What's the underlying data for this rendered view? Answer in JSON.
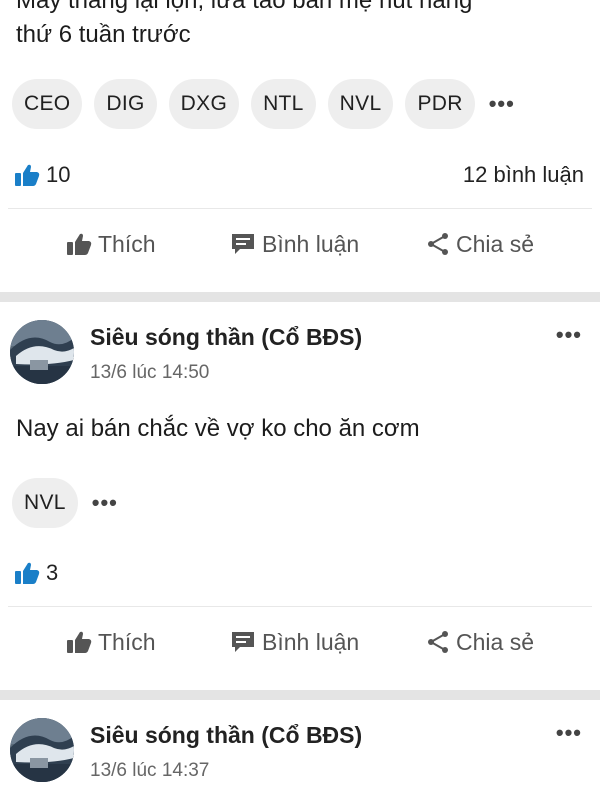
{
  "post1": {
    "text_line1": "Mấy tháng lại lộn, lừa tao bán mẹ hút hàng",
    "text_line2": "thứ 6 tuần trước",
    "tags": [
      "CEO",
      "DIG",
      "DXG",
      "NTL",
      "NVL",
      "PDR"
    ],
    "more": "•••",
    "likes": "10",
    "comments": "12 bình luận"
  },
  "post2": {
    "author": "Siêu sóng thần (Cổ BĐS)",
    "time": "13/6 lúc 14:50",
    "text": "Nay ai bán chắc về vợ ko cho ăn cơm",
    "tags": [
      "NVL"
    ],
    "more": "•••",
    "likes": "3"
  },
  "post3": {
    "author": "Siêu sóng thần (Cổ BĐS)",
    "time": "13/6 lúc 14:37"
  },
  "actions": {
    "like": "Thích",
    "comment": "Bình luận",
    "share": "Chia sẻ"
  },
  "menu_dots": "•••",
  "colors": {
    "like_blue": "#1a7fc8",
    "separator": "#e4e4e4",
    "tag_bg": "#eeeeee"
  },
  "icons": [
    "thumbs-up-icon",
    "comment-icon",
    "share-icon",
    "more-icon"
  ]
}
